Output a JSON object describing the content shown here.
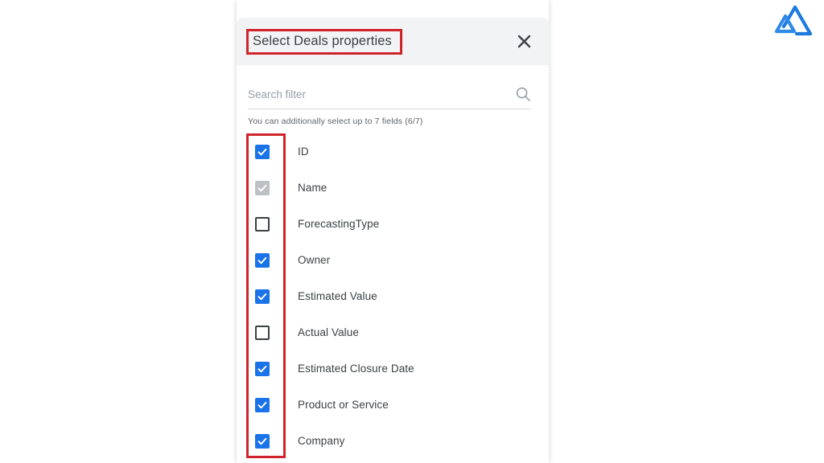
{
  "brand": {
    "logo_icon": "mountain-logo-icon",
    "color": "#1f7ae0"
  },
  "panel": {
    "title": "Select Deals properties",
    "close_icon": "close-icon",
    "search": {
      "placeholder": "Search filter",
      "value": "",
      "icon": "search-icon"
    },
    "helper_text": "You can additionally select up to 7 fields (6/7)",
    "fields": [
      {
        "label": "ID",
        "state": "checked"
      },
      {
        "label": "Name",
        "state": "checked-disabled"
      },
      {
        "label": "ForecastingType",
        "state": "unchecked"
      },
      {
        "label": "Owner",
        "state": "checked"
      },
      {
        "label": "Estimated Value",
        "state": "checked"
      },
      {
        "label": "Actual Value",
        "state": "unchecked"
      },
      {
        "label": "Estimated Closure Date",
        "state": "checked"
      },
      {
        "label": "Product or Service",
        "state": "checked"
      },
      {
        "label": "Company",
        "state": "checked"
      }
    ]
  },
  "annotations": {
    "color": "#d0242c",
    "items": [
      {
        "name": "title-highlight"
      },
      {
        "name": "checkbox-column-highlight"
      }
    ]
  }
}
